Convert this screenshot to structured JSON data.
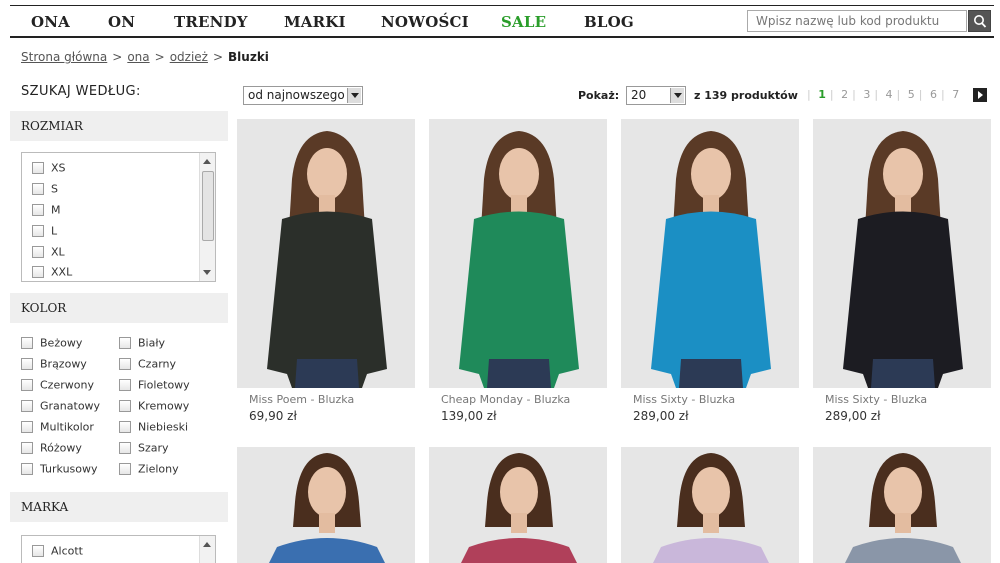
{
  "nav": {
    "items": [
      "ONA",
      "ON",
      "TRENDY",
      "MARKI",
      "NOWOŚCI",
      "SALE",
      "BLOG"
    ],
    "search_placeholder": "Wpisz nazwę lub kod produktu"
  },
  "breadcrumb": {
    "items": [
      "Strona główna",
      "ona",
      "odzież"
    ],
    "current": "Bluzki",
    "separator": ">"
  },
  "sidebar": {
    "title": "SZUKAJ WEDŁUG:",
    "size_section": {
      "title": "ROZMIAR",
      "options": [
        "XS",
        "S",
        "M",
        "L",
        "XL",
        "XXL"
      ]
    },
    "color_section": {
      "title": "KOLOR",
      "options_left": [
        "Beżowy",
        "Brązowy",
        "Czerwony",
        "Granatowy",
        "Multikolor",
        "Różowy",
        "Turkusowy"
      ],
      "options_right": [
        "Biały",
        "Czarny",
        "Fioletowy",
        "Kremowy",
        "Niebieski",
        "Szary",
        "Zielony"
      ]
    },
    "brand_section": {
      "title": "MARKA",
      "options": [
        "Alcott"
      ]
    }
  },
  "toolbar": {
    "sort_value": "od najnowszego",
    "show_label": "Pokaż:",
    "per_page": "20",
    "of_label": "z 139 produktów",
    "pages": [
      "1",
      "2",
      "3",
      "4",
      "5",
      "6",
      "7"
    ],
    "active_page": "1"
  },
  "products": [
    {
      "name": "Miss Poem - Bluzka",
      "price": "69,90 zł",
      "color": "#2b2f2a"
    },
    {
      "name": "Cheap Monday - Bluzka",
      "price": "139,00 zł",
      "color": "#1f8a5a"
    },
    {
      "name": "Miss Sixty - Bluzka",
      "price": "289,00 zł",
      "color": "#1b8fc4"
    },
    {
      "name": "Miss Sixty - Bluzka",
      "price": "289,00 zł",
      "color": "#1c1c22"
    }
  ],
  "products_row2": [
    {
      "color": "#3a6fb0"
    },
    {
      "color": "#b0405a"
    },
    {
      "color": "#c9b7da"
    },
    {
      "color": "#8a96a8"
    }
  ]
}
